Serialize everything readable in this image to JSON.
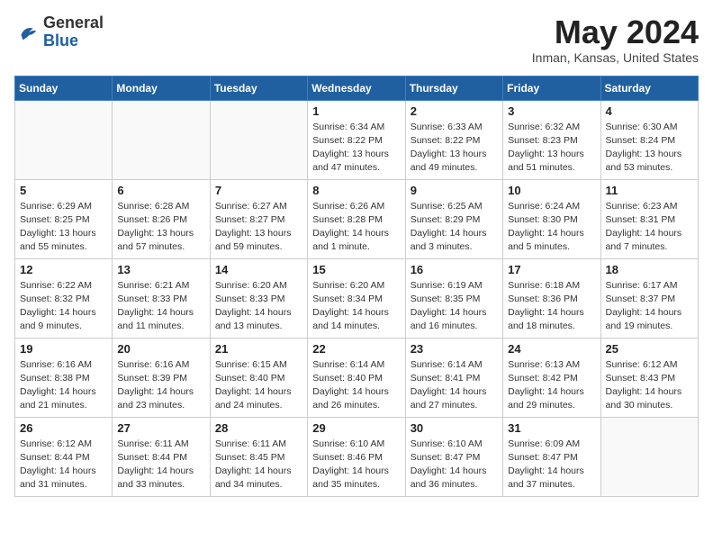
{
  "header": {
    "logo_line1": "General",
    "logo_line2": "Blue",
    "month_year": "May 2024",
    "location": "Inman, Kansas, United States"
  },
  "days_of_week": [
    "Sunday",
    "Monday",
    "Tuesday",
    "Wednesday",
    "Thursday",
    "Friday",
    "Saturday"
  ],
  "weeks": [
    [
      {
        "day": "",
        "info": ""
      },
      {
        "day": "",
        "info": ""
      },
      {
        "day": "",
        "info": ""
      },
      {
        "day": "1",
        "info": "Sunrise: 6:34 AM\nSunset: 8:22 PM\nDaylight: 13 hours\nand 47 minutes."
      },
      {
        "day": "2",
        "info": "Sunrise: 6:33 AM\nSunset: 8:22 PM\nDaylight: 13 hours\nand 49 minutes."
      },
      {
        "day": "3",
        "info": "Sunrise: 6:32 AM\nSunset: 8:23 PM\nDaylight: 13 hours\nand 51 minutes."
      },
      {
        "day": "4",
        "info": "Sunrise: 6:30 AM\nSunset: 8:24 PM\nDaylight: 13 hours\nand 53 minutes."
      }
    ],
    [
      {
        "day": "5",
        "info": "Sunrise: 6:29 AM\nSunset: 8:25 PM\nDaylight: 13 hours\nand 55 minutes."
      },
      {
        "day": "6",
        "info": "Sunrise: 6:28 AM\nSunset: 8:26 PM\nDaylight: 13 hours\nand 57 minutes."
      },
      {
        "day": "7",
        "info": "Sunrise: 6:27 AM\nSunset: 8:27 PM\nDaylight: 13 hours\nand 59 minutes."
      },
      {
        "day": "8",
        "info": "Sunrise: 6:26 AM\nSunset: 8:28 PM\nDaylight: 14 hours\nand 1 minute."
      },
      {
        "day": "9",
        "info": "Sunrise: 6:25 AM\nSunset: 8:29 PM\nDaylight: 14 hours\nand 3 minutes."
      },
      {
        "day": "10",
        "info": "Sunrise: 6:24 AM\nSunset: 8:30 PM\nDaylight: 14 hours\nand 5 minutes."
      },
      {
        "day": "11",
        "info": "Sunrise: 6:23 AM\nSunset: 8:31 PM\nDaylight: 14 hours\nand 7 minutes."
      }
    ],
    [
      {
        "day": "12",
        "info": "Sunrise: 6:22 AM\nSunset: 8:32 PM\nDaylight: 14 hours\nand 9 minutes."
      },
      {
        "day": "13",
        "info": "Sunrise: 6:21 AM\nSunset: 8:33 PM\nDaylight: 14 hours\nand 11 minutes."
      },
      {
        "day": "14",
        "info": "Sunrise: 6:20 AM\nSunset: 8:33 PM\nDaylight: 14 hours\nand 13 minutes."
      },
      {
        "day": "15",
        "info": "Sunrise: 6:20 AM\nSunset: 8:34 PM\nDaylight: 14 hours\nand 14 minutes."
      },
      {
        "day": "16",
        "info": "Sunrise: 6:19 AM\nSunset: 8:35 PM\nDaylight: 14 hours\nand 16 minutes."
      },
      {
        "day": "17",
        "info": "Sunrise: 6:18 AM\nSunset: 8:36 PM\nDaylight: 14 hours\nand 18 minutes."
      },
      {
        "day": "18",
        "info": "Sunrise: 6:17 AM\nSunset: 8:37 PM\nDaylight: 14 hours\nand 19 minutes."
      }
    ],
    [
      {
        "day": "19",
        "info": "Sunrise: 6:16 AM\nSunset: 8:38 PM\nDaylight: 14 hours\nand 21 minutes."
      },
      {
        "day": "20",
        "info": "Sunrise: 6:16 AM\nSunset: 8:39 PM\nDaylight: 14 hours\nand 23 minutes."
      },
      {
        "day": "21",
        "info": "Sunrise: 6:15 AM\nSunset: 8:40 PM\nDaylight: 14 hours\nand 24 minutes."
      },
      {
        "day": "22",
        "info": "Sunrise: 6:14 AM\nSunset: 8:40 PM\nDaylight: 14 hours\nand 26 minutes."
      },
      {
        "day": "23",
        "info": "Sunrise: 6:14 AM\nSunset: 8:41 PM\nDaylight: 14 hours\nand 27 minutes."
      },
      {
        "day": "24",
        "info": "Sunrise: 6:13 AM\nSunset: 8:42 PM\nDaylight: 14 hours\nand 29 minutes."
      },
      {
        "day": "25",
        "info": "Sunrise: 6:12 AM\nSunset: 8:43 PM\nDaylight: 14 hours\nand 30 minutes."
      }
    ],
    [
      {
        "day": "26",
        "info": "Sunrise: 6:12 AM\nSunset: 8:44 PM\nDaylight: 14 hours\nand 31 minutes."
      },
      {
        "day": "27",
        "info": "Sunrise: 6:11 AM\nSunset: 8:44 PM\nDaylight: 14 hours\nand 33 minutes."
      },
      {
        "day": "28",
        "info": "Sunrise: 6:11 AM\nSunset: 8:45 PM\nDaylight: 14 hours\nand 34 minutes."
      },
      {
        "day": "29",
        "info": "Sunrise: 6:10 AM\nSunset: 8:46 PM\nDaylight: 14 hours\nand 35 minutes."
      },
      {
        "day": "30",
        "info": "Sunrise: 6:10 AM\nSunset: 8:47 PM\nDaylight: 14 hours\nand 36 minutes."
      },
      {
        "day": "31",
        "info": "Sunrise: 6:09 AM\nSunset: 8:47 PM\nDaylight: 14 hours\nand 37 minutes."
      },
      {
        "day": "",
        "info": ""
      }
    ]
  ]
}
